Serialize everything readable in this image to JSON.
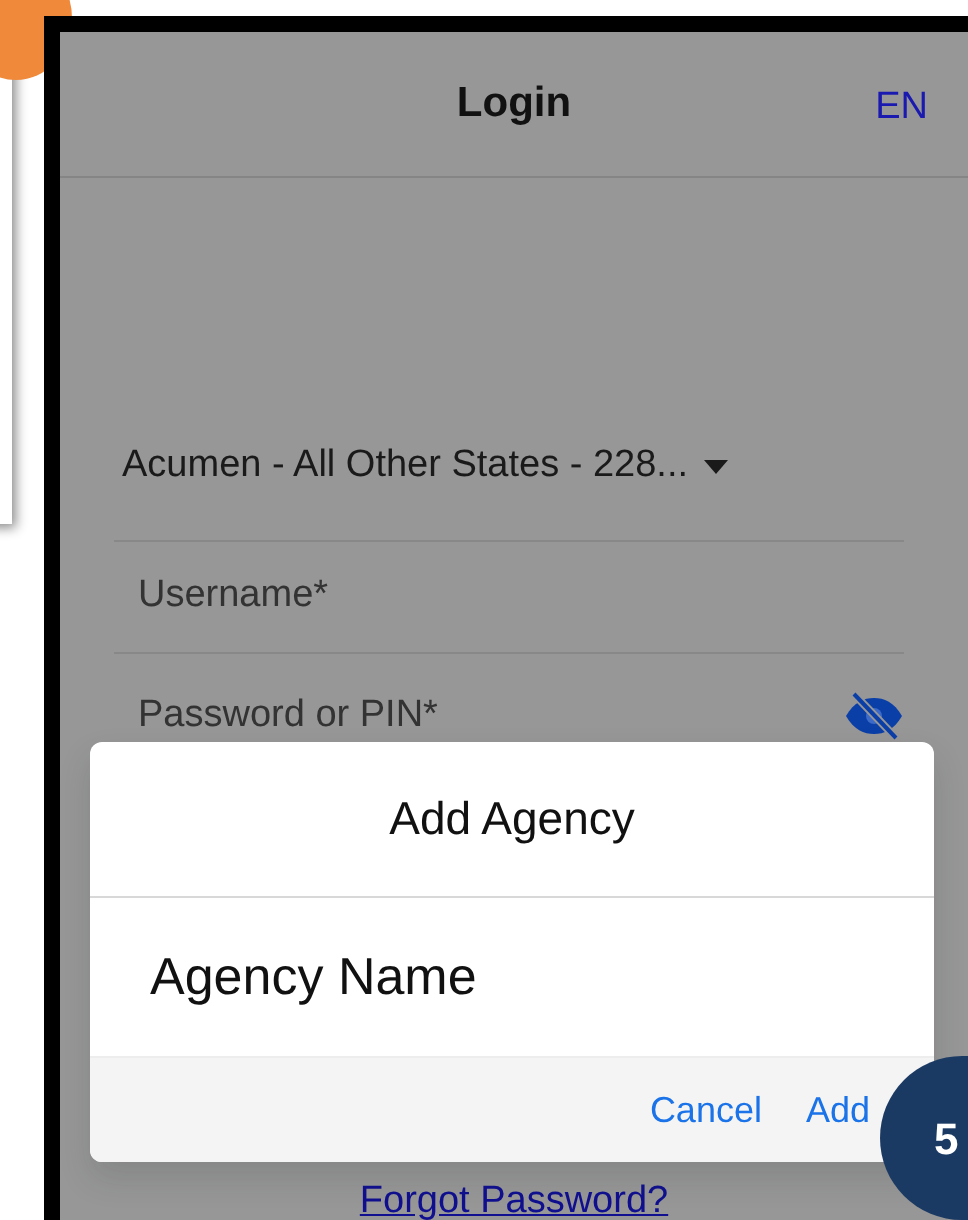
{
  "screen": {
    "title": "Login",
    "language": "EN"
  },
  "form": {
    "agency": "Acumen - All Other States - 228...",
    "username": {
      "placeholder": "Username*"
    },
    "password": {
      "placeholder": "Password or PIN*",
      "visible": false
    },
    "forgot_password": "Forgot Password?"
  },
  "dialog": {
    "title": "Add Agency",
    "field": {
      "value": "Agency Name"
    },
    "buttons": [
      "Cancel",
      "Add"
    ]
  },
  "step_badge": "5"
}
